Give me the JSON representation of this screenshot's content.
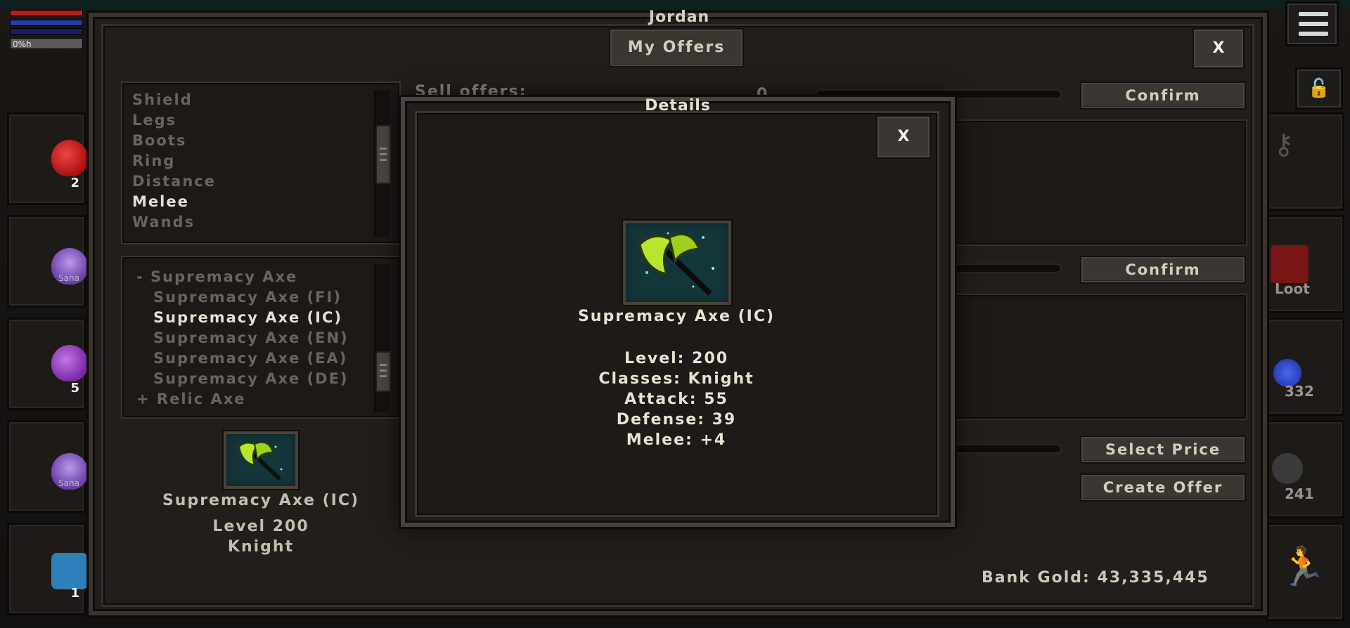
{
  "hud": {
    "xp_label": "0%h"
  },
  "left_hotbar": [
    {
      "count": "2",
      "tag": ""
    },
    {
      "count": "",
      "tag": "Sana"
    },
    {
      "count": "5",
      "tag": ""
    },
    {
      "count": "",
      "tag": "Sana"
    },
    {
      "count": "1",
      "tag": ""
    }
  ],
  "right_hotbar": [
    {
      "label": ""
    },
    {
      "label": "Loot"
    },
    {
      "label": "332"
    },
    {
      "label": "241"
    },
    {
      "label": ""
    }
  ],
  "window": {
    "title": "Jordan",
    "my_offers_label": "My Offers",
    "close_label": "X"
  },
  "categories": {
    "items": [
      "Shield",
      "Legs",
      "Boots",
      "Ring",
      "Distance",
      "Melee",
      "Wands"
    ],
    "selected": "Melee"
  },
  "item_list": {
    "items": [
      "- Supremacy Axe",
      "Supremacy Axe (FI)",
      "Supremacy Axe (IC)",
      "Supremacy Axe (EN)",
      "Supremacy Axe (EA)",
      "Supremacy Axe (DE)",
      "+ Relic Axe"
    ],
    "selected": "Supremacy Axe (IC)"
  },
  "preview": {
    "name": "Supremacy Axe (IC)",
    "level": "Level 200",
    "class": "Knight"
  },
  "sell": {
    "label": "Sell offers:",
    "count": "0",
    "confirm_label": "Confirm"
  },
  "buy": {
    "confirm_label": "Confirm"
  },
  "create": {
    "select_price_label": "Select Price",
    "create_offer_label": "Create Offer"
  },
  "bank_gold": "Bank Gold: 43,335,445",
  "details": {
    "title": "Details",
    "close_label": "X",
    "name": "Supremacy Axe (IC)",
    "lines": [
      "Level: 200",
      "Classes: Knight",
      "Attack: 55",
      "Defense: 39",
      "Melee: +4"
    ]
  },
  "colors": {
    "window_bg": "#221e1b",
    "accent_text": "#e8e1d4",
    "dim_text": "#6a645c",
    "item_glow": "#2ec4d6",
    "axe_green": "#b8e630"
  },
  "icons": [
    "menu-icon",
    "lock-icon",
    "axe-icon",
    "potion-icon",
    "runner-icon"
  ]
}
